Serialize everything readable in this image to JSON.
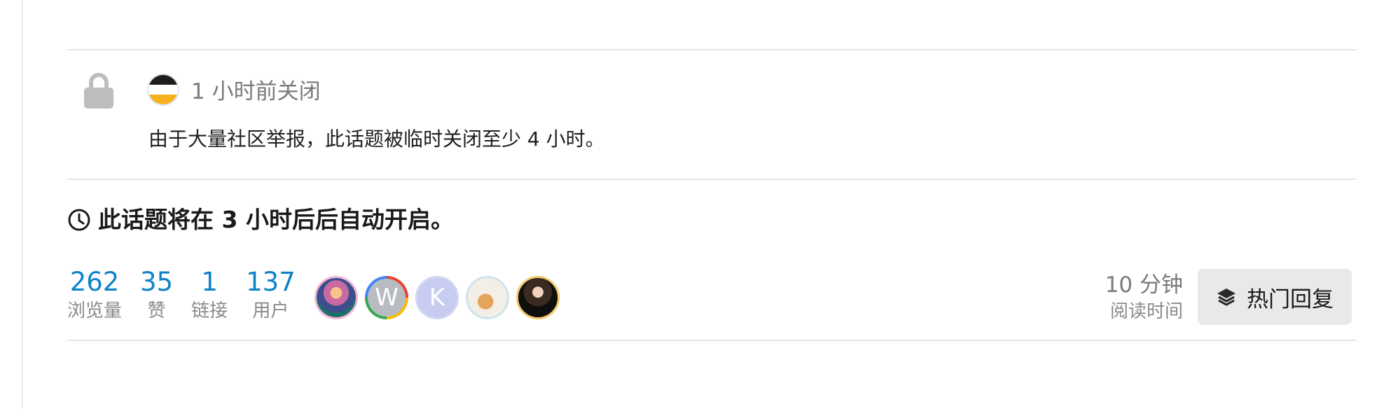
{
  "closed_post": {
    "meta": "1 小时前关闭",
    "body": "由于大量社区举报，此话题被临时关闭至少 4 小时。"
  },
  "notice": {
    "text": "此话题将在 3 小时后后自动开启。",
    "icon": "clock-icon"
  },
  "stats": [
    {
      "value": "262",
      "label": "浏览量"
    },
    {
      "value": "35",
      "label": "赞"
    },
    {
      "value": "1",
      "label": "链接"
    },
    {
      "value": "137",
      "label": "用户"
    }
  ],
  "participants": [
    {
      "name": "avatar-landscape",
      "letter": ""
    },
    {
      "name": "avatar-w",
      "letter": "W"
    },
    {
      "name": "avatar-k",
      "letter": "K"
    },
    {
      "name": "avatar-cat",
      "letter": ""
    },
    {
      "name": "avatar-person",
      "letter": ""
    }
  ],
  "read_time": {
    "value": "10 分钟",
    "label": "阅读时间"
  },
  "summary_button": {
    "label": "热门回复",
    "icon": "layers-icon"
  },
  "colors": {
    "link_blue": "#0f82c8",
    "muted": "#8a8a8a",
    "button_bg": "#e9e9e9"
  }
}
